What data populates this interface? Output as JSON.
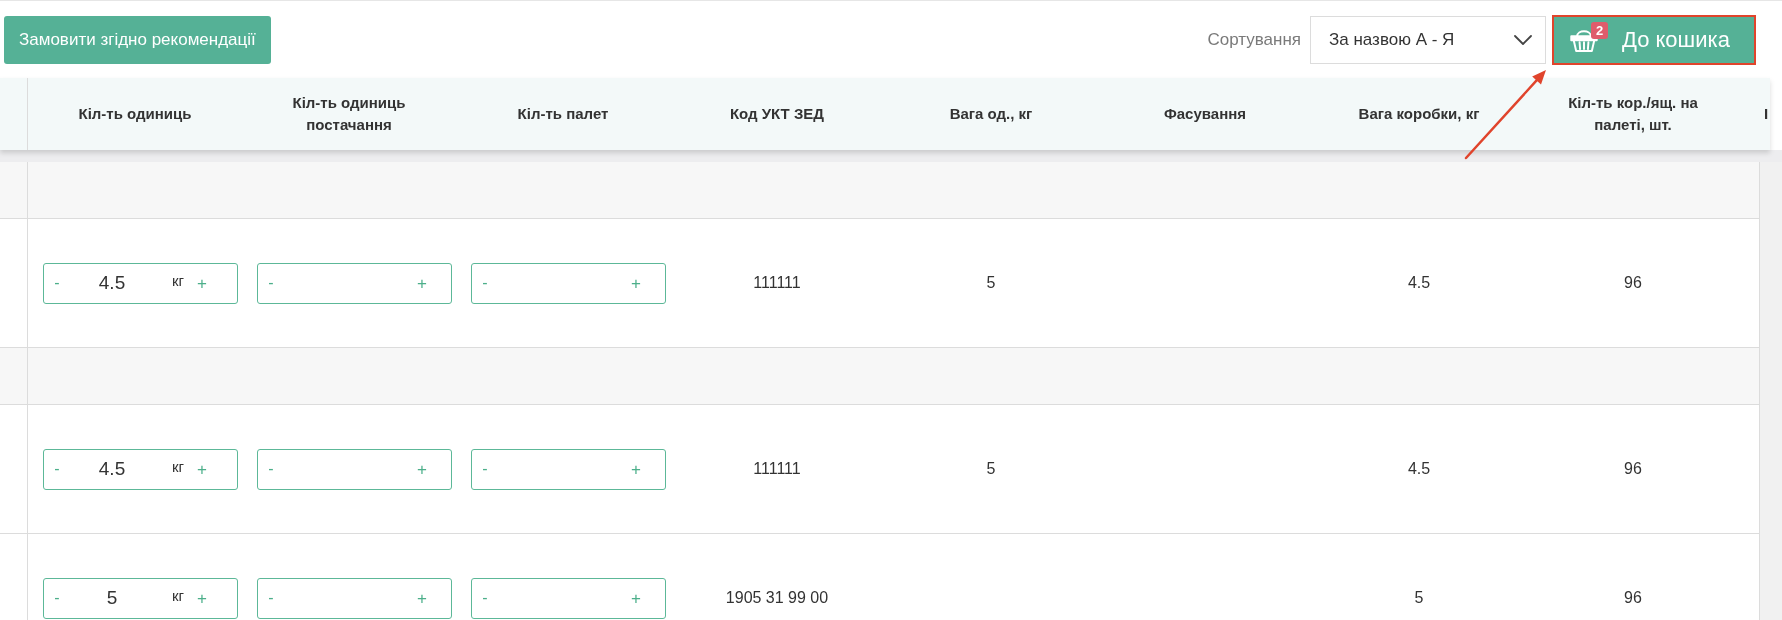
{
  "toolbar": {
    "recommend_button": "Замовити згідно рекомендації",
    "sort": {
      "label": "Сортування",
      "value": "За назвою А - Я"
    },
    "cart_button": {
      "label": "До кошика",
      "count": "2",
      "highlighted": true
    }
  },
  "table": {
    "columns": [
      "Кіл-ть одиниць",
      "Кіл-ть одиниць постачання",
      "Кіл-ть палет",
      "Код УКТ ЗЕД",
      "Вага од., кг",
      "Фасування",
      "Вага коробки, кг",
      "Кіл-ть кор./ящ. на палеті, шт.",
      "І"
    ],
    "rows": [
      {
        "kind": "group"
      },
      {
        "kind": "product",
        "steppers": [
          {
            "minus": "-",
            "value": "4.5",
            "unit": "кг",
            "plus": "+"
          },
          {
            "minus": "-",
            "plus": "+"
          },
          {
            "minus": "-",
            "plus": "+"
          }
        ],
        "ukt_zed": "111111",
        "unit_weight": "5",
        "box_weight": "4.5",
        "per_pallet": "96"
      },
      {
        "kind": "group"
      },
      {
        "kind": "product",
        "steppers": [
          {
            "minus": "-",
            "value": "4.5",
            "unit": "кг",
            "plus": "+"
          },
          {
            "minus": "-",
            "plus": "+"
          },
          {
            "minus": "-",
            "plus": "+"
          }
        ],
        "ukt_zed": "111111",
        "unit_weight": "5",
        "box_weight": "4.5",
        "per_pallet": "96"
      },
      {
        "kind": "product",
        "steppers": [
          {
            "minus": "-",
            "value": "5",
            "unit": "кг",
            "plus": "+"
          },
          {
            "minus": "-",
            "plus": "+"
          },
          {
            "minus": "-",
            "plus": "+"
          }
        ],
        "ukt_zed": "1905 31 99 00",
        "box_weight": "5",
        "per_pallet": "96"
      }
    ]
  }
}
